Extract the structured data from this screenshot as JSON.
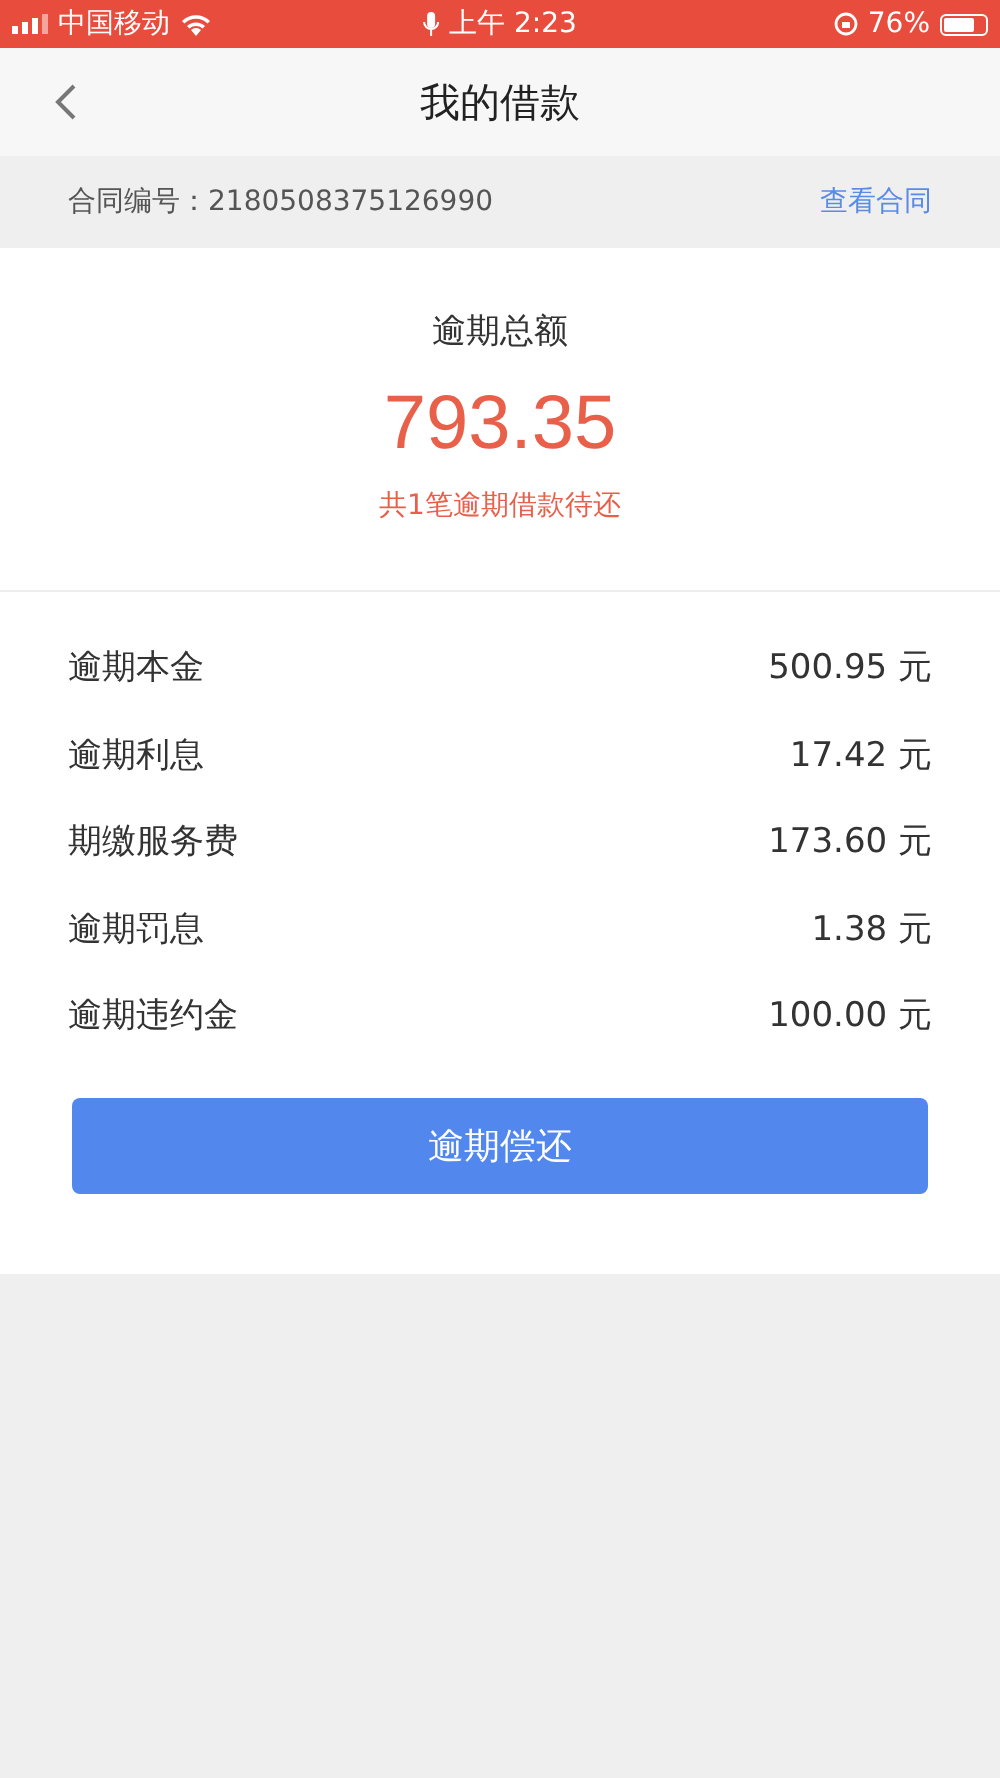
{
  "status_bar": {
    "carrier": "中国移动",
    "time": "上午 2:23",
    "battery": "76%"
  },
  "nav": {
    "title": "我的借款"
  },
  "contract": {
    "label": "合同编号：2180508375126990",
    "link": "查看合同"
  },
  "summary": {
    "title": "逾期总额",
    "amount": "793.35",
    "note": "共1笔逾期借款待还"
  },
  "items": [
    {
      "label": "逾期本金",
      "value": "500.95 元"
    },
    {
      "label": "逾期利息",
      "value": "17.42 元"
    },
    {
      "label": "期缴服务费",
      "value": "173.60 元"
    },
    {
      "label": "逾期罚息",
      "value": "1.38 元"
    },
    {
      "label": "逾期违约金",
      "value": "100.00 元"
    }
  ],
  "button": "逾期偿还"
}
